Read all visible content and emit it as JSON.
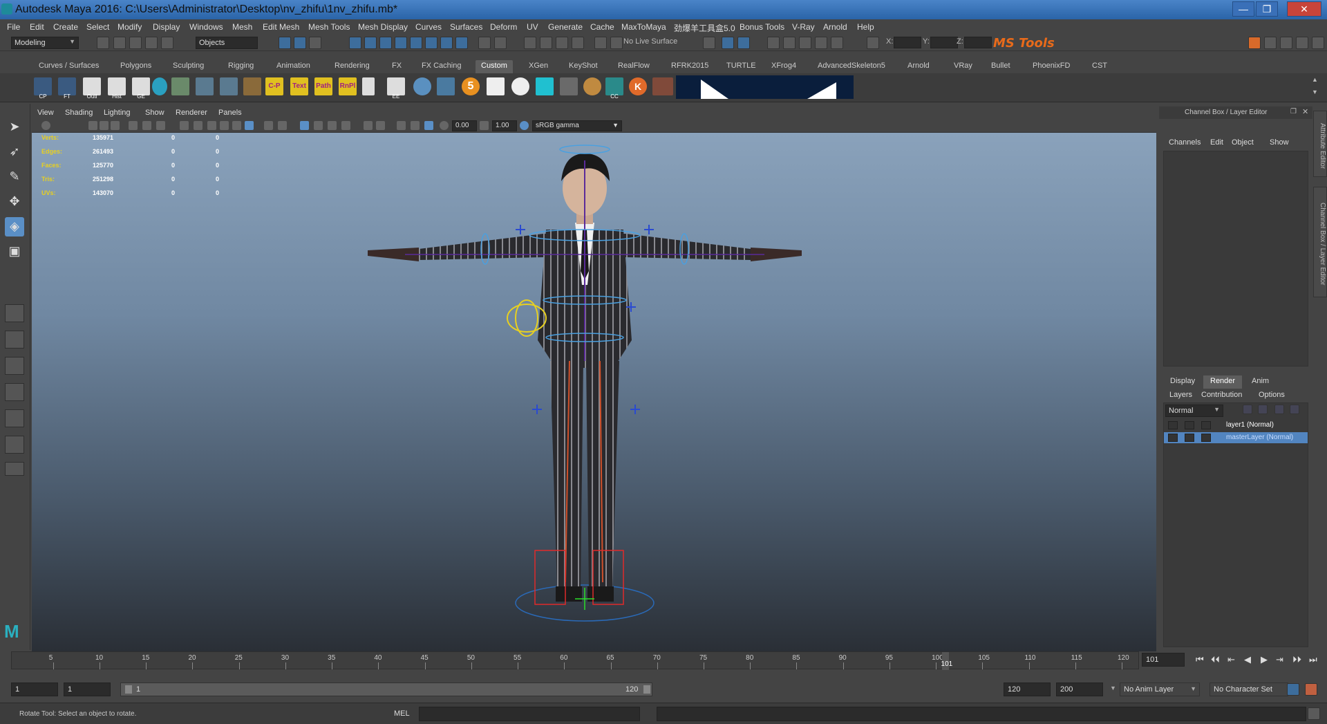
{
  "window": {
    "title": "Autodesk Maya 2016: C:\\Users\\Administrator\\Desktop\\nv_zhifu\\1nv_zhifu.mb*",
    "min": "—",
    "max": "❐",
    "close": "✕"
  },
  "menubar": [
    "File",
    "Edit",
    "Create",
    "Select",
    "Modify",
    "Display",
    "Windows",
    "Mesh",
    "Edit Mesh",
    "Mesh Tools",
    "Mesh Display",
    "Curves",
    "Surfaces",
    "Deform",
    "UV",
    "Generate",
    "Cache",
    "MaxToMaya",
    "劲爆羊工具盒5.0",
    "Bonus Tools",
    "V-Ray",
    "Arnold",
    "Help"
  ],
  "statusline": {
    "mode": "Modeling",
    "select_mode": "Objects",
    "live_surface": "No Live Surface",
    "x_label": "X:",
    "y_label": "Y:",
    "z_label": "Z:",
    "mstools": "MS Tools"
  },
  "shelf": {
    "tabs": [
      "Curves / Surfaces",
      "Polygons",
      "Sculpting",
      "Rigging",
      "Animation",
      "Rendering",
      "FX",
      "FX Caching",
      "Custom",
      "XGen",
      "KeyShot",
      "RealFlow",
      "RFRK2015",
      "TURTLE",
      "XFrog4",
      "AdvancedSkeleton5",
      "Arnold",
      "VRay",
      "Bullet",
      "PhoenixFD",
      "CST"
    ],
    "active_tab": "Custom",
    "icon_labels": [
      "CP",
      "FT",
      "Outl",
      "Hist",
      "GE",
      "EE",
      "CC"
    ],
    "text_icons": [
      "C-P",
      "Text",
      "Path",
      "RnPl"
    ],
    "five": "5",
    "k": "K"
  },
  "panel": {
    "menu": [
      "View",
      "Shading",
      "Lighting",
      "Show",
      "Renderer",
      "Panels"
    ],
    "exposure": "0.00",
    "gamma": "1.00",
    "colorspace": "sRGB gamma"
  },
  "hud": [
    {
      "label": "Verts:",
      "value": "135971",
      "a": "0",
      "b": "0"
    },
    {
      "label": "Edges:",
      "value": "261493",
      "a": "0",
      "b": "0"
    },
    {
      "label": "Faces:",
      "value": "125770",
      "a": "0",
      "b": "0"
    },
    {
      "label": "Tris:",
      "value": "251298",
      "a": "0",
      "b": "0"
    },
    {
      "label": "UVs:",
      "value": "143070",
      "a": "0",
      "b": "0"
    }
  ],
  "channelbox": {
    "title": "Channel Box / Layer Editor",
    "menu": [
      "Channels",
      "Edit",
      "Object",
      "Show"
    ],
    "tabs": [
      "Display",
      "Render",
      "Anim"
    ],
    "active_tab": "Render",
    "submenu": [
      "Layers",
      "Contribution",
      "Options"
    ],
    "blend": "Normal",
    "layers": [
      "layer1 (Normal)",
      "masterLayer (Normal)"
    ],
    "side_tabs": [
      "Attribute Editor",
      "Channel Box / Layer Editor"
    ]
  },
  "timeline": {
    "ticks": [
      "5",
      "10",
      "15",
      "20",
      "25",
      "30",
      "35",
      "40",
      "45",
      "50",
      "55",
      "60",
      "65",
      "70",
      "75",
      "80",
      "85",
      "90",
      "95",
      "100",
      "105",
      "110",
      "115",
      "120"
    ],
    "current": "101",
    "current_field": "101"
  },
  "range": {
    "start": "1",
    "playback_start": "1",
    "slider_start": "1",
    "slider_end": "120",
    "playback_end": "120",
    "end": "200",
    "anim_layer": "No Anim Layer",
    "char_set": "No Character Set"
  },
  "commandline": {
    "help": "Rotate Tool: Select an object to rotate.",
    "mel": "MEL"
  }
}
